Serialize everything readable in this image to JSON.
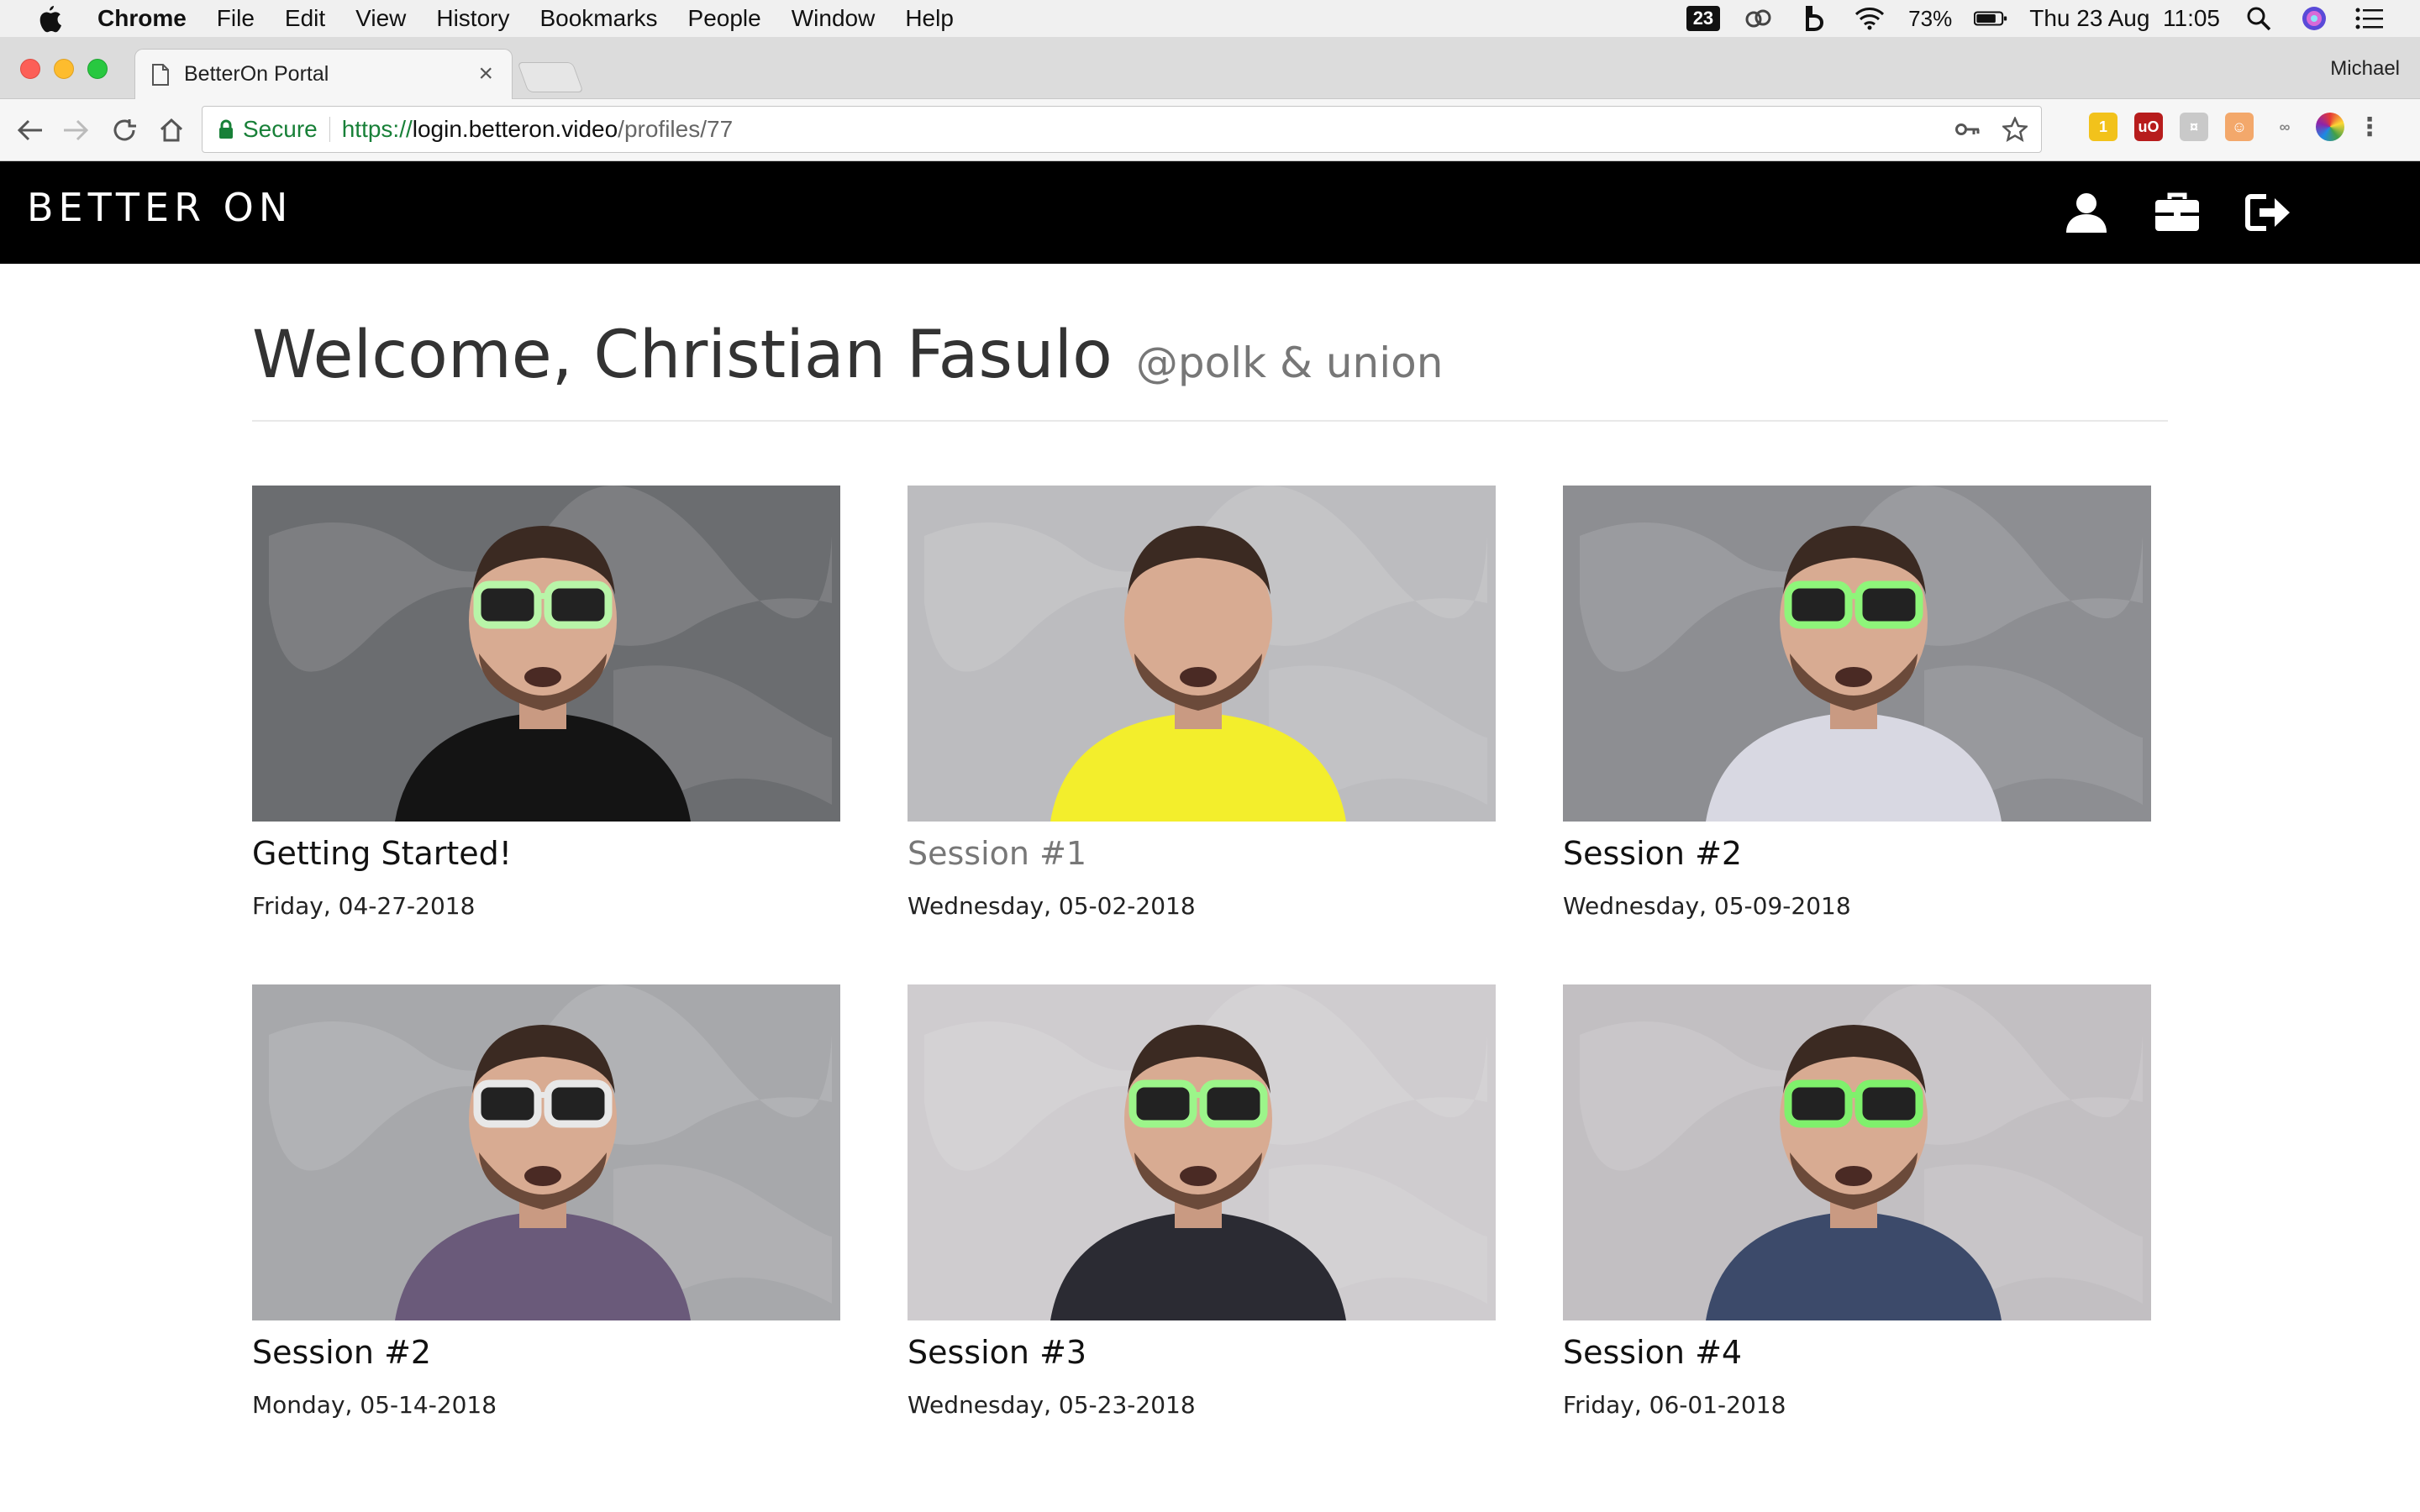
{
  "menubar": {
    "app": "Chrome",
    "items": [
      "File",
      "Edit",
      "View",
      "History",
      "Bookmarks",
      "People",
      "Window",
      "Help"
    ],
    "badge": "23",
    "battery": "73%",
    "datetime": "Thu 23 Aug  11:05"
  },
  "browser": {
    "tab_title": "BetterOn Portal",
    "tab_close": "×",
    "profile_name": "Michael",
    "secure_label": "Secure",
    "url_scheme": "https://",
    "url_host": "login.betteron.video",
    "url_path": "/profiles/77"
  },
  "header": {
    "brand": "BETTER ON"
  },
  "welcome": {
    "title": "Welcome, Christian Fasulo",
    "company": "@polk & union"
  },
  "sessions": [
    {
      "title": "Getting Started!",
      "date": "Friday, 04-27-2018",
      "bg": "#6b6d70",
      "shirt": "#141414",
      "glasses": "#b8f5a8",
      "muted": false
    },
    {
      "title": "Session #1",
      "date": "Wednesday, 05-02-2018",
      "bg": "#bcbcbf",
      "shirt": "#f3ee2c",
      "glasses": "none",
      "muted": true
    },
    {
      "title": "Session #2",
      "date": "Wednesday, 05-09-2018",
      "bg": "#8d8e92",
      "shirt": "#d8d8e2",
      "glasses": "#8ef57a",
      "muted": false
    },
    {
      "title": "Session #2",
      "date": "Monday, 05-14-2018",
      "bg": "#a7a8ab",
      "shirt": "#6a5a7a",
      "glasses": "#e8e8e8",
      "muted": false
    },
    {
      "title": "Session #3",
      "date": "Wednesday, 05-23-2018",
      "bg": "#cfcccf",
      "shirt": "#2b2b33",
      "glasses": "#9cf58a",
      "muted": false
    },
    {
      "title": "Session #4",
      "date": "Friday, 06-01-2018",
      "bg": "#c2bfc2",
      "shirt": "#3c4a6a",
      "glasses": "#7ff06c",
      "muted": false
    }
  ]
}
